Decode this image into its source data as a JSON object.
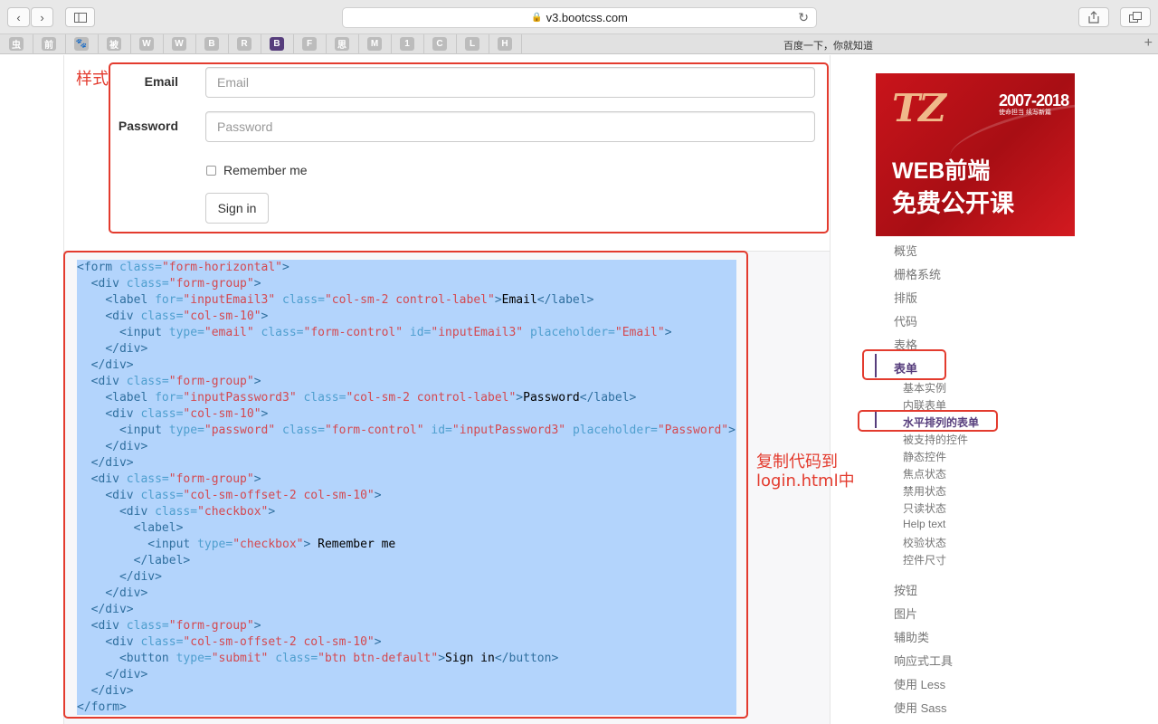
{
  "browser": {
    "url": "v3.bootcss.com",
    "bookmarks": [
      "虫",
      "前",
      "🐾",
      "被",
      "W",
      "W",
      "B",
      "R",
      "B",
      "F",
      "思",
      "M",
      "1",
      "C",
      "L",
      "H"
    ],
    "bookmarks_bar_title": "百度一下，你就知道"
  },
  "annotations": {
    "style_label": "样式",
    "copy_line1": "复制代码到",
    "copy_line2": "login.html中"
  },
  "form_example": {
    "email_label": "Email",
    "email_placeholder": "Email",
    "password_label": "Password",
    "password_placeholder": "Password",
    "remember_label": "Remember me",
    "signin_label": "Sign in"
  },
  "promo": {
    "logo": "TZ",
    "years": "2007-2018",
    "slogan": "使命担当 续写新篇",
    "line1": "WEB前端",
    "line2": "免费公开课"
  },
  "sidebar": {
    "items": [
      "概览",
      "栅格系统",
      "排版",
      "代码",
      "表格",
      "表单"
    ],
    "active_item": "表单",
    "sub_items": [
      "基本实例",
      "内联表单",
      "水平排列的表单",
      "被支持的控件",
      "静态控件",
      "焦点状态",
      "禁用状态",
      "只读状态",
      "Help text",
      "校验状态",
      "控件尺寸"
    ],
    "active_sub_item": "水平排列的表单",
    "items_after": [
      "按钮",
      "图片",
      "辅助类",
      "响应式工具",
      "使用 Less",
      "使用 Sass"
    ]
  },
  "colors": {
    "accent": "#563d7c",
    "annotation": "#e33b2e",
    "code_selection": "#b3d4fc"
  }
}
